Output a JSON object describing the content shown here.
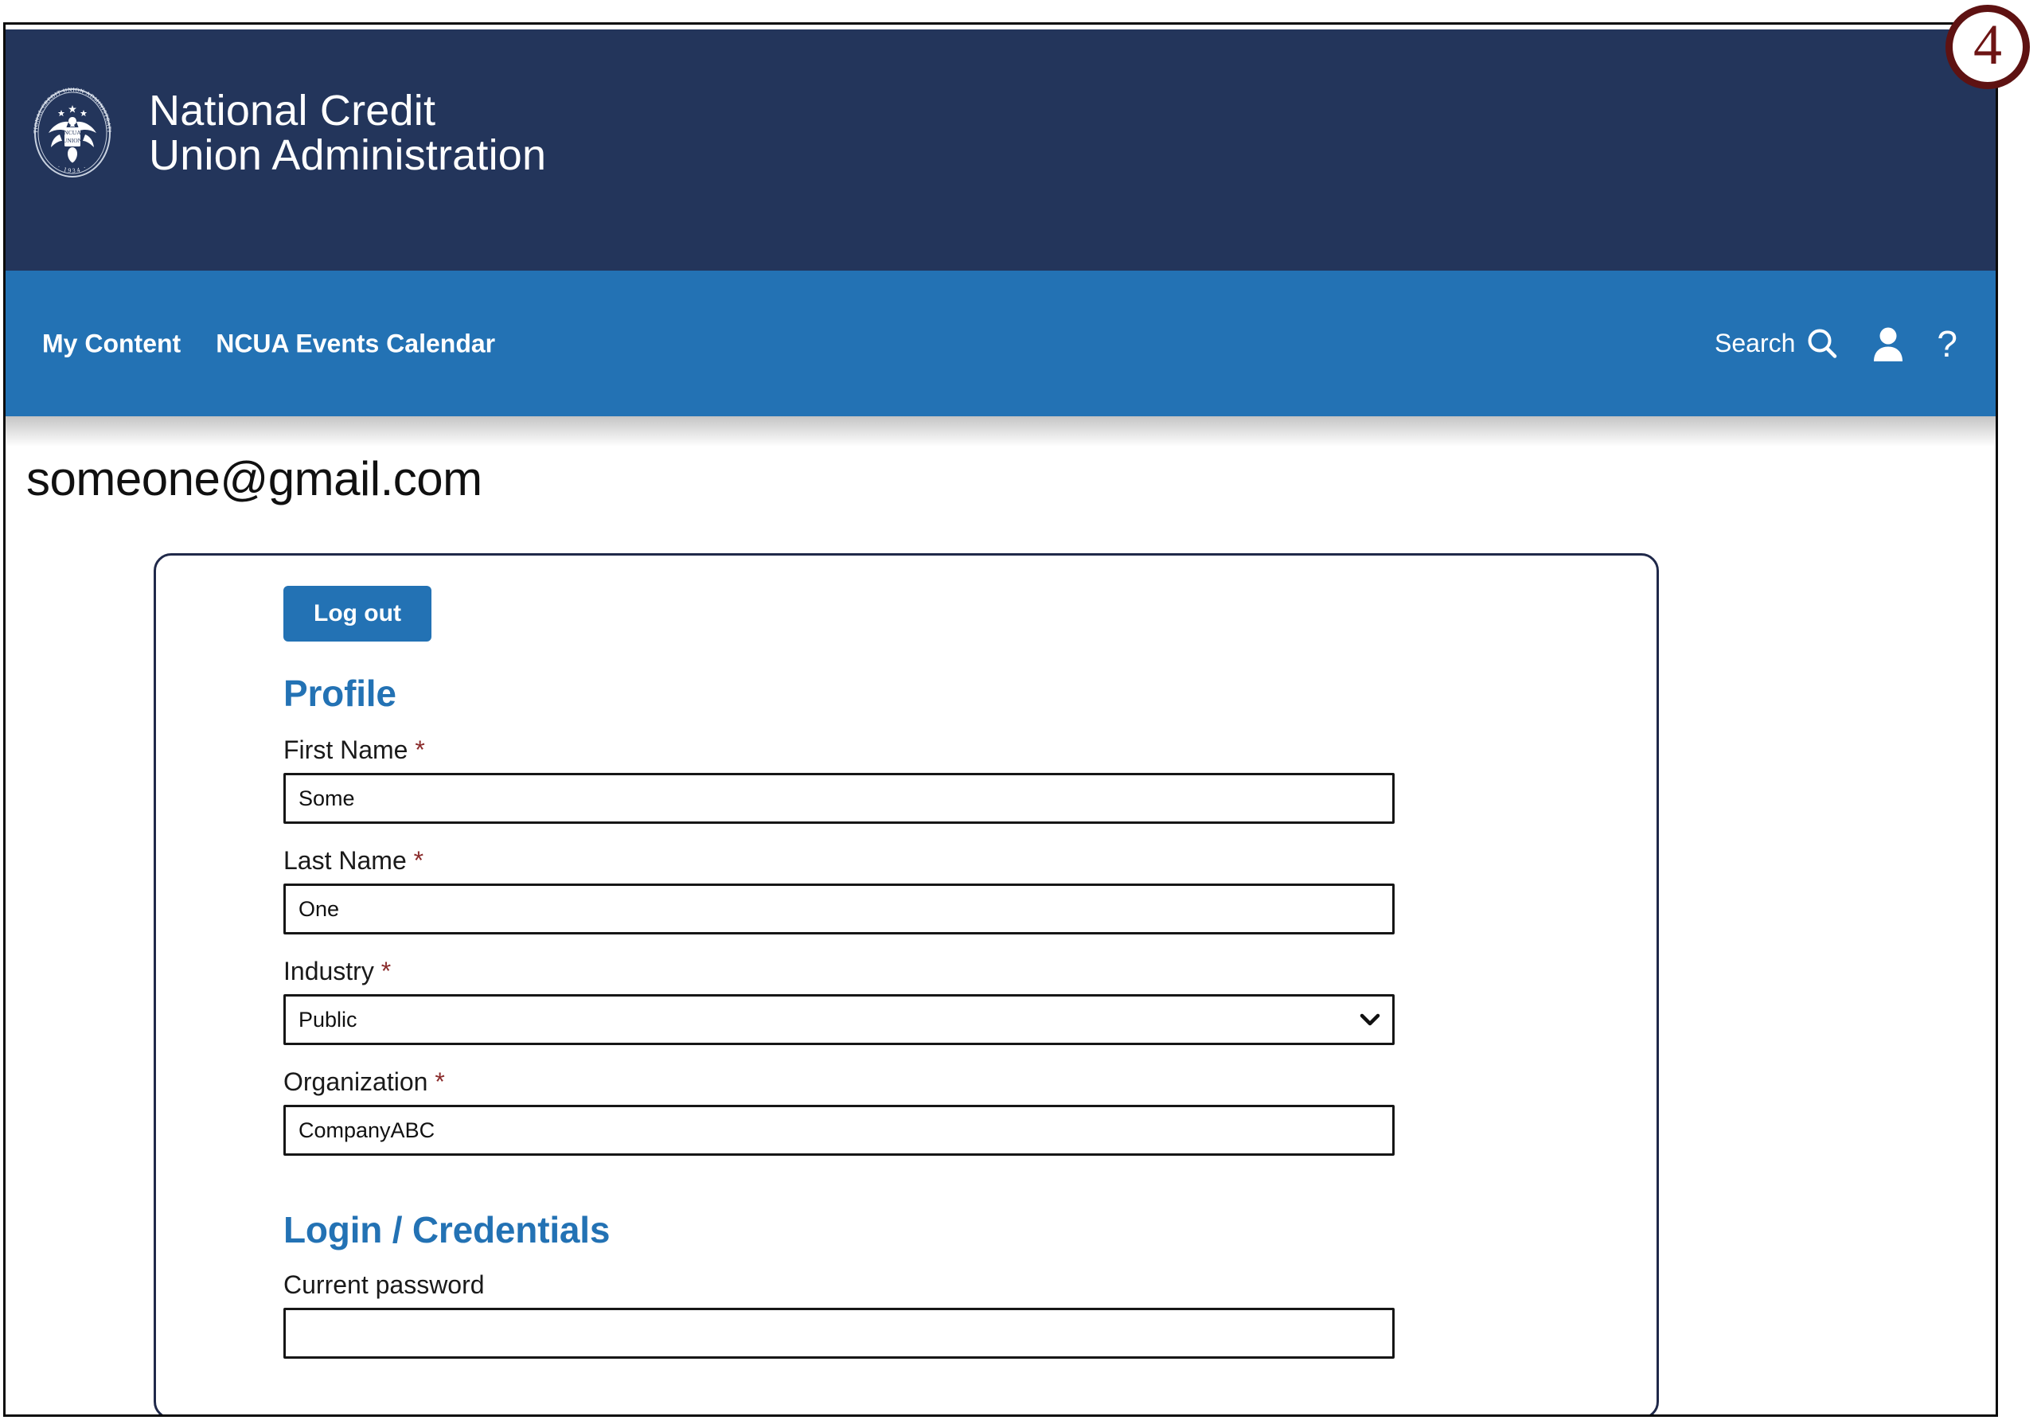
{
  "header": {
    "agency_name": "National Credit\nUnion Administration",
    "seal_text_top": "NATIONAL CREDIT UNION ADMINISTRATION",
    "seal_year": "1934",
    "seal_icon": "eagle-seal-icon",
    "bg_color": "#23355b"
  },
  "utility_nav": {
    "bg_color": "#2372b4",
    "links": [
      {
        "label": "My Content"
      },
      {
        "label": "NCUA Events Calendar"
      }
    ],
    "search_label": "Search",
    "search_icon": "magnifier-icon",
    "account_icon": "user-person-icon",
    "help_label": "?",
    "help_icon": "question-mark-icon"
  },
  "page": {
    "title": "someone@gmail.com"
  },
  "card": {
    "logout_label": "Log out",
    "profile": {
      "heading": "Profile",
      "fields": [
        {
          "label": "First Name",
          "required": "*",
          "type": "text",
          "value": "Some",
          "placeholder": ""
        },
        {
          "label": "Last Name",
          "required": "*",
          "type": "text",
          "value": "One",
          "placeholder": ""
        },
        {
          "label": "Industry",
          "required": "*",
          "type": "select",
          "value": "Public",
          "options": [
            "Public"
          ],
          "chevron_icon": "chevron-down-icon"
        },
        {
          "label": "Organization",
          "required": "*",
          "type": "text",
          "value": "CompanyABC",
          "placeholder": ""
        }
      ]
    },
    "credentials": {
      "heading": "Login / Credentials",
      "fields": [
        {
          "label": "Current password",
          "required": "",
          "type": "password",
          "value": "",
          "placeholder": ""
        }
      ]
    }
  },
  "annotation": {
    "step_number": "4",
    "color": "#6d1414"
  }
}
